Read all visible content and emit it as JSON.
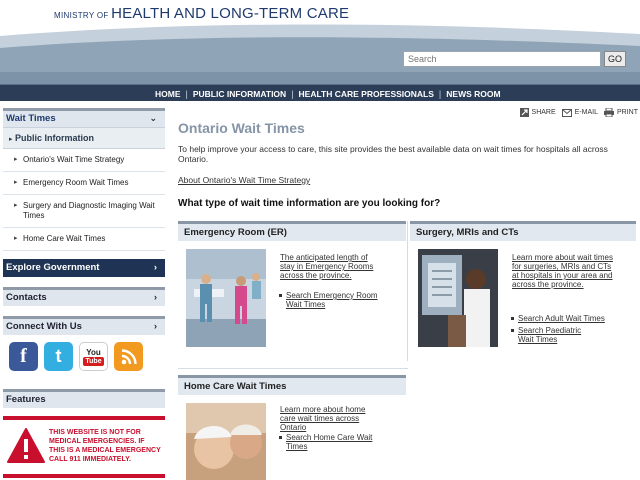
{
  "header": {
    "ministry_prefix": "MINISTRY OF",
    "ministry_name": "HEALTH AND LONG-TERM CARE",
    "search_placeholder": "Search",
    "search_button": "GO"
  },
  "nav": [
    {
      "label": "HOME"
    },
    {
      "label": "PUBLIC INFORMATION"
    },
    {
      "label": "HEALTH CARE PROFESSIONALS"
    },
    {
      "label": "NEWS ROOM"
    }
  ],
  "sidebar": {
    "wait_times_title": "Wait Times",
    "public_info": "Public Information",
    "links": [
      "Ontario's Wait Time Strategy",
      "Emergency Room Wait Times",
      "Surgery and Diagnostic Imaging Wait Times",
      "Home Care Wait Times"
    ],
    "explore": "Explore Government",
    "contacts": "Contacts",
    "connect": "Connect With Us",
    "features": "Features",
    "warning": "THIS WEBSITE IS NOT FOR MEDICAL EMERGENCIES. IF THIS IS A MEDICAL EMERGENCY CALL 911 IMMEDIATELY."
  },
  "tools": {
    "share": "SHARE",
    "email": "E-MAIL",
    "print": "PRINT"
  },
  "main": {
    "title": "Ontario Wait Times",
    "intro": "To help improve your access to care, this site provides the best available data on wait times for hospitals all across Ontario.",
    "about_link": "About Ontario's Wait Time Strategy",
    "question": "What type of wait time information are you looking for?",
    "cards": [
      {
        "title": "Emergency Room (ER)",
        "desc": "The anticipated length of stay in Emergency Rooms across the province.",
        "links": [
          "Search Emergency Room Wait Times"
        ]
      },
      {
        "title": "Surgery, MRIs and CTs",
        "desc": "Learn more about wait times for surgeries, MRIs and CTs at hospitals in your area and across the province.",
        "links": [
          "Search Adult Wait Times",
          "Search Paediatric Wait Times"
        ]
      },
      {
        "title": "Home Care Wait Times",
        "desc": "Learn more about home care wait times across Ontario",
        "links": [
          "Search Home Care Wait Times"
        ]
      }
    ]
  },
  "colors": {
    "navbar": "#2b3d57",
    "warning_red": "#c8102e",
    "title_gray": "#8594a6"
  }
}
